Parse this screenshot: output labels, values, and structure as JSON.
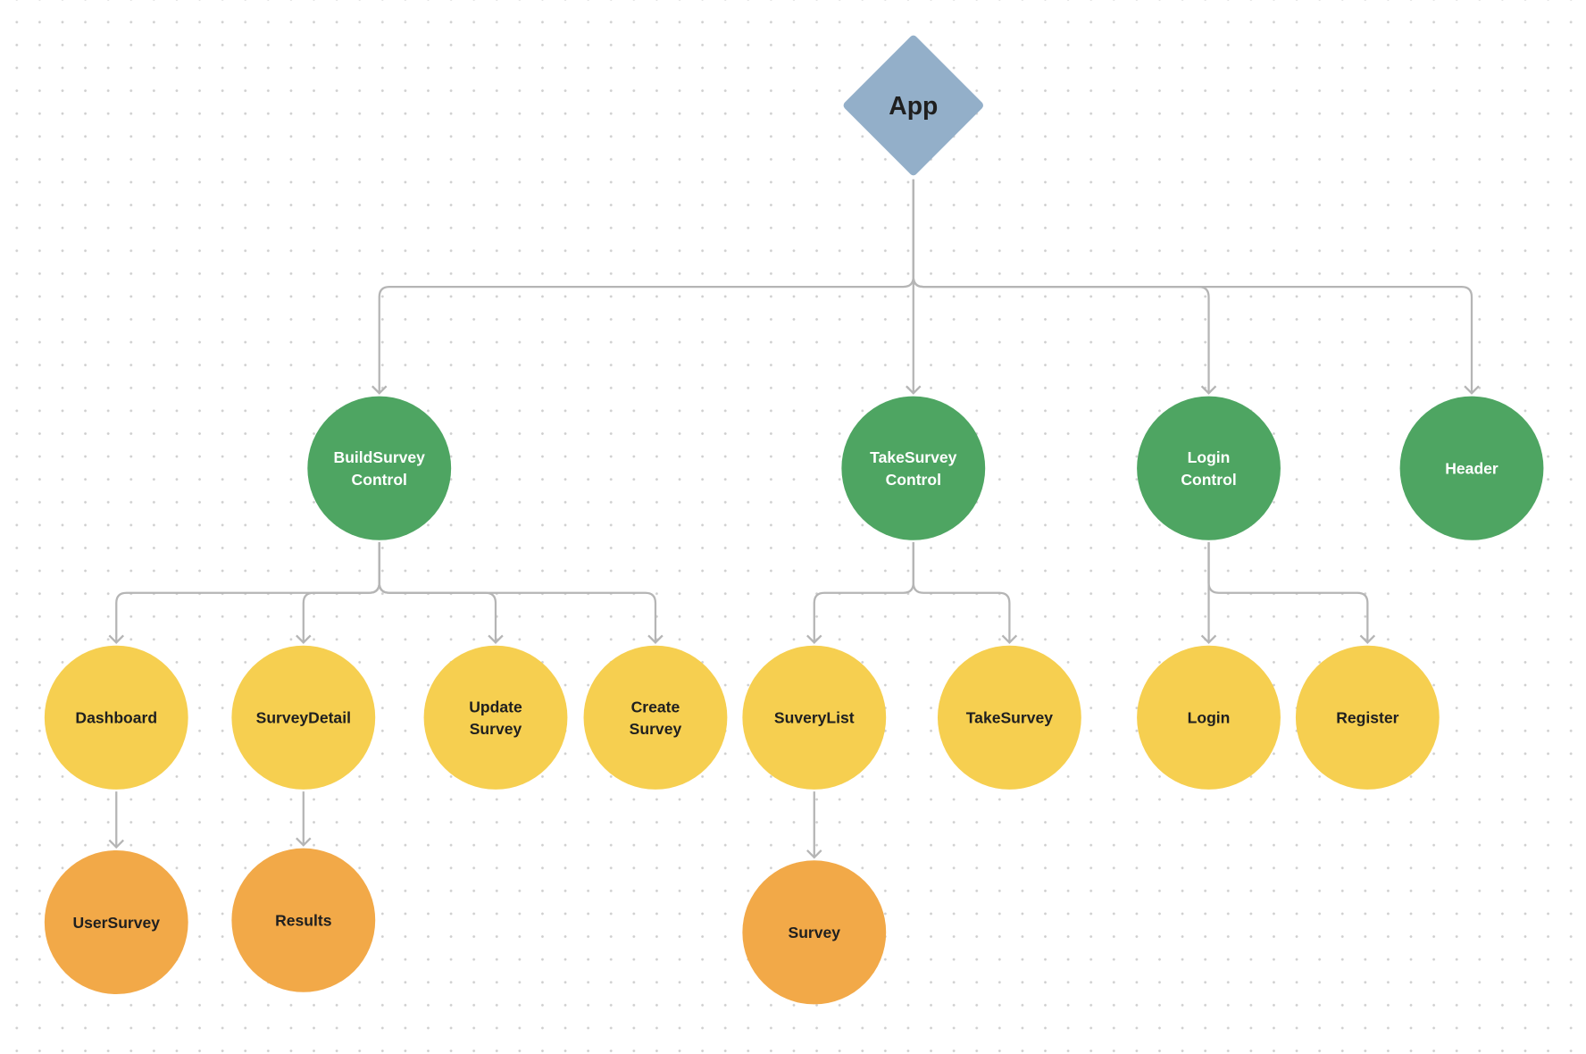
{
  "diagram": {
    "root": {
      "id": "app",
      "label": [
        "App"
      ],
      "shape": "diamond"
    },
    "nodes": [
      {
        "id": "build",
        "label": [
          "BuildSurvey",
          "Control"
        ],
        "parent": "app",
        "level": 1
      },
      {
        "id": "take",
        "label": [
          "TakeSurvey",
          "Control"
        ],
        "parent": "app",
        "level": 1
      },
      {
        "id": "loginc",
        "label": [
          "Login",
          "Control"
        ],
        "parent": "app",
        "level": 1
      },
      {
        "id": "header",
        "label": [
          "Header"
        ],
        "parent": "app",
        "level": 1
      },
      {
        "id": "dashboard",
        "label": [
          "Dashboard"
        ],
        "parent": "build",
        "level": 2
      },
      {
        "id": "surveydetail",
        "label": [
          "SurveyDetail"
        ],
        "parent": "build",
        "level": 2
      },
      {
        "id": "update",
        "label": [
          "Update",
          "Survey"
        ],
        "parent": "build",
        "level": 2
      },
      {
        "id": "create",
        "label": [
          "Create",
          "Survey"
        ],
        "parent": "build",
        "level": 2
      },
      {
        "id": "suverylist",
        "label": [
          "SuveryList"
        ],
        "parent": "take",
        "level": 2
      },
      {
        "id": "takesurvey",
        "label": [
          "TakeSurvey"
        ],
        "parent": "take",
        "level": 2
      },
      {
        "id": "login",
        "label": [
          "Login"
        ],
        "parent": "loginc",
        "level": 2
      },
      {
        "id": "register",
        "label": [
          "Register"
        ],
        "parent": "loginc",
        "level": 2
      },
      {
        "id": "usersurvey",
        "label": [
          "UserSurvey"
        ],
        "parent": "dashboard",
        "level": 3
      },
      {
        "id": "results",
        "label": [
          "Results"
        ],
        "parent": "surveydetail",
        "level": 3
      },
      {
        "id": "survey",
        "label": [
          "Survey"
        ],
        "parent": "suverylist",
        "level": 3
      }
    ],
    "colors": {
      "root": "#93afc9",
      "level1": "#4ea562",
      "level2": "#f6cf50",
      "level3": "#f2a948",
      "edge": "#b5b5b5",
      "text_light": "#ffffff",
      "text_dark": "#1f1f1f"
    }
  }
}
